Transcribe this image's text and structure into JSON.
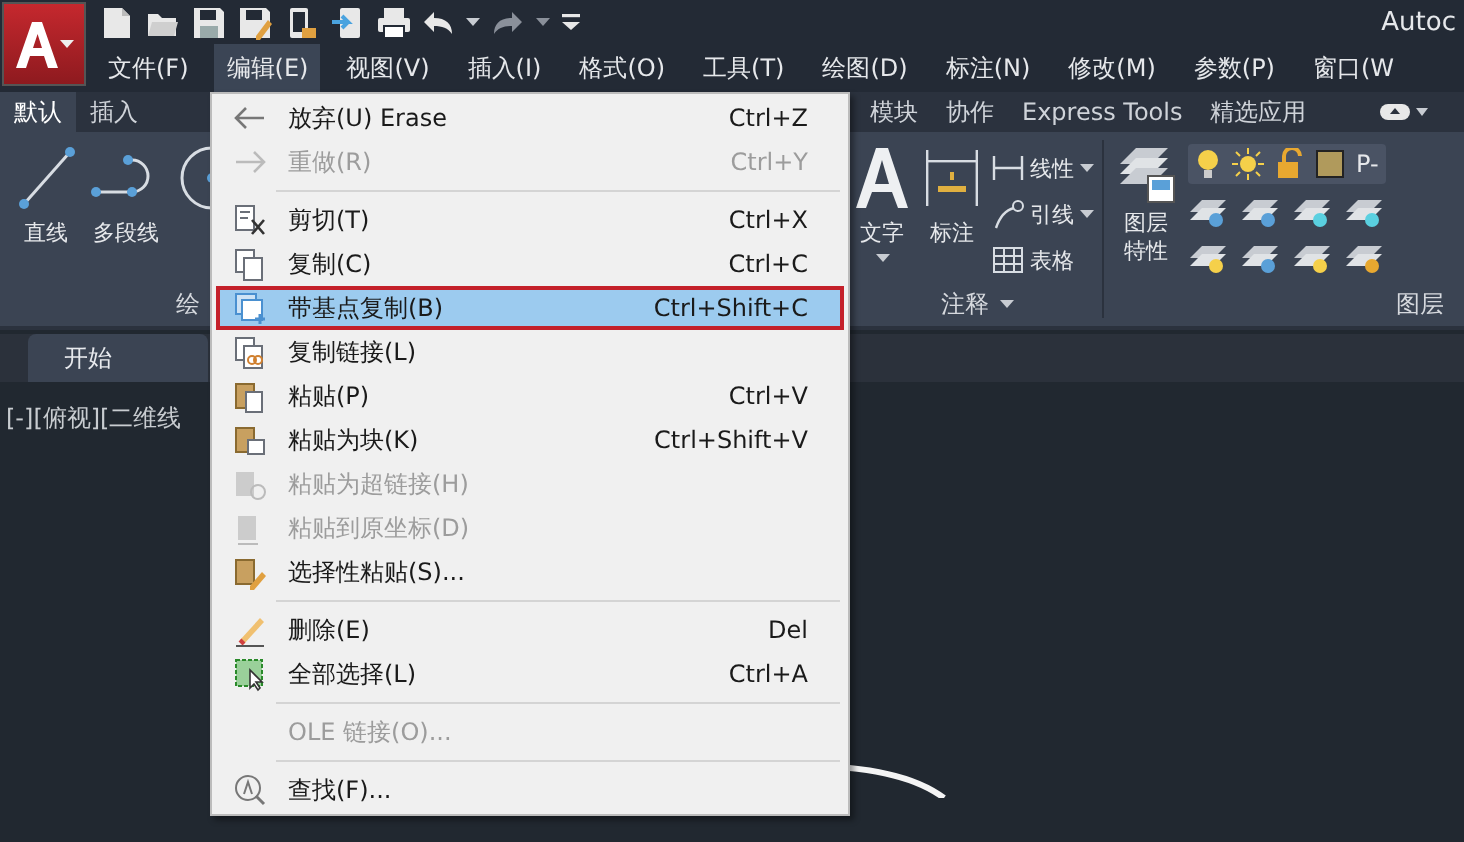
{
  "app": {
    "title": "Autoc"
  },
  "menu_bar": [
    {
      "label": "文件(F)",
      "selected": false
    },
    {
      "label": "编辑(E)",
      "selected": true
    },
    {
      "label": "视图(V)",
      "selected": false
    },
    {
      "label": "插入(I)",
      "selected": false
    },
    {
      "label": "格式(O)",
      "selected": false
    },
    {
      "label": "工具(T)",
      "selected": false
    },
    {
      "label": "绘图(D)",
      "selected": false
    },
    {
      "label": "标注(N)",
      "selected": false
    },
    {
      "label": "修改(M)",
      "selected": false
    },
    {
      "label": "参数(P)",
      "selected": false
    },
    {
      "label": "窗口(W",
      "selected": false
    }
  ],
  "ribbon_tabs": [
    {
      "label": "默认",
      "selected": true
    },
    {
      "label": "插入",
      "selected": false
    },
    {
      "label": "模块",
      "selected": false
    },
    {
      "label": "协作",
      "selected": false
    },
    {
      "label": "Express Tools",
      "selected": false
    },
    {
      "label": "精选应用",
      "selected": false
    }
  ],
  "ribbon": {
    "draw_panel": {
      "title": "绘",
      "tools": [
        {
          "label": "直线"
        },
        {
          "label": "多段线"
        }
      ]
    },
    "annotation_panel": {
      "title": "注释",
      "title_dropdown": true,
      "large_tools": [
        {
          "label": "文字",
          "dropdown": true
        },
        {
          "label": "标注",
          "dropdown": false
        }
      ],
      "small_tools": [
        {
          "label": "线性",
          "dropdown": true
        },
        {
          "label": "引线",
          "dropdown": true
        },
        {
          "label": "表格",
          "dropdown": false
        }
      ]
    },
    "layers_panel": {
      "title": "图层",
      "tool": "图层特性",
      "layer_name": "P-"
    }
  },
  "document_tabs": [
    {
      "label": "开始",
      "selected": true
    }
  ],
  "viewport": {
    "label": "[-][俯视][二维线"
  },
  "edit_menu": [
    {
      "kind": "item",
      "label": "放弃(U) Erase",
      "shortcut": "Ctrl+Z",
      "disabled": false,
      "selected": false
    },
    {
      "kind": "item",
      "label": "重做(R)",
      "shortcut": "Ctrl+Y",
      "disabled": true,
      "selected": false
    },
    {
      "kind": "separator"
    },
    {
      "kind": "item",
      "label": "剪切(T)",
      "shortcut": "Ctrl+X",
      "disabled": false,
      "selected": false
    },
    {
      "kind": "item",
      "label": "复制(C)",
      "shortcut": "Ctrl+C",
      "disabled": false,
      "selected": false
    },
    {
      "kind": "item",
      "label": "带基点复制(B)",
      "shortcut": "Ctrl+Shift+C",
      "disabled": false,
      "selected": true
    },
    {
      "kind": "item",
      "label": "复制链接(L)",
      "disabled": false,
      "selected": false
    },
    {
      "kind": "item",
      "label": "粘贴(P)",
      "shortcut": "Ctrl+V",
      "disabled": false,
      "selected": false
    },
    {
      "kind": "item",
      "label": "粘贴为块(K)",
      "shortcut": "Ctrl+Shift+V",
      "disabled": false,
      "selected": false
    },
    {
      "kind": "item",
      "label": "粘贴为超链接(H)",
      "disabled": true,
      "selected": false
    },
    {
      "kind": "item",
      "label": "粘贴到原坐标(D)",
      "disabled": true,
      "selected": false
    },
    {
      "kind": "item",
      "label": "选择性粘贴(S)...",
      "disabled": false,
      "selected": false
    },
    {
      "kind": "separator"
    },
    {
      "kind": "item",
      "label": "删除(E)",
      "shortcut": "Del",
      "disabled": false,
      "selected": false
    },
    {
      "kind": "item",
      "label": "全部选择(L)",
      "shortcut": "Ctrl+A",
      "disabled": false,
      "selected": false
    },
    {
      "kind": "separator"
    },
    {
      "kind": "item",
      "label": "OLE 链接(O)...",
      "disabled": true,
      "selected": false
    },
    {
      "kind": "separator"
    },
    {
      "kind": "item",
      "label": "查找(F)...",
      "disabled": false,
      "selected": false
    }
  ]
}
